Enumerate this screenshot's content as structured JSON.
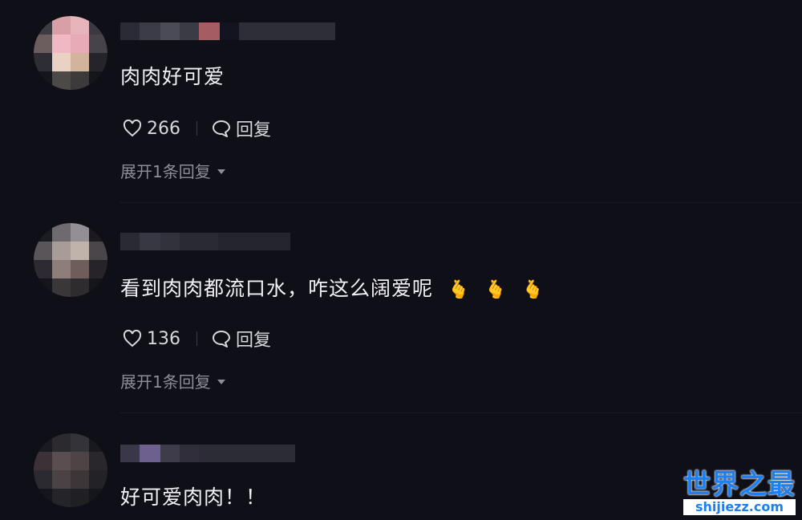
{
  "comments": [
    {
      "text": "肉肉好可爱",
      "likes": "266",
      "reply_label": "回复",
      "expand_label": "展开1条回复",
      "emojis": []
    },
    {
      "text": "看到肉肉都流口水，咋这么阔爱呢",
      "likes": "136",
      "reply_label": "回复",
      "expand_label": "展开1条回复",
      "emojis": [
        "🫰",
        "🫰",
        "🫰"
      ]
    },
    {
      "text": "好可爱肉肉！！"
    }
  ],
  "icons": {
    "like": "heart-icon",
    "reply": "speech-bubble-icon",
    "expand": "caret-down-icon"
  },
  "watermark": {
    "logo": "世界之最",
    "url": "shijiezz.com"
  },
  "colors": {
    "background": "#0f0f17",
    "text": "#f1f1f5",
    "muted": "#8d8d97",
    "watermark": "#1e7ff0"
  }
}
